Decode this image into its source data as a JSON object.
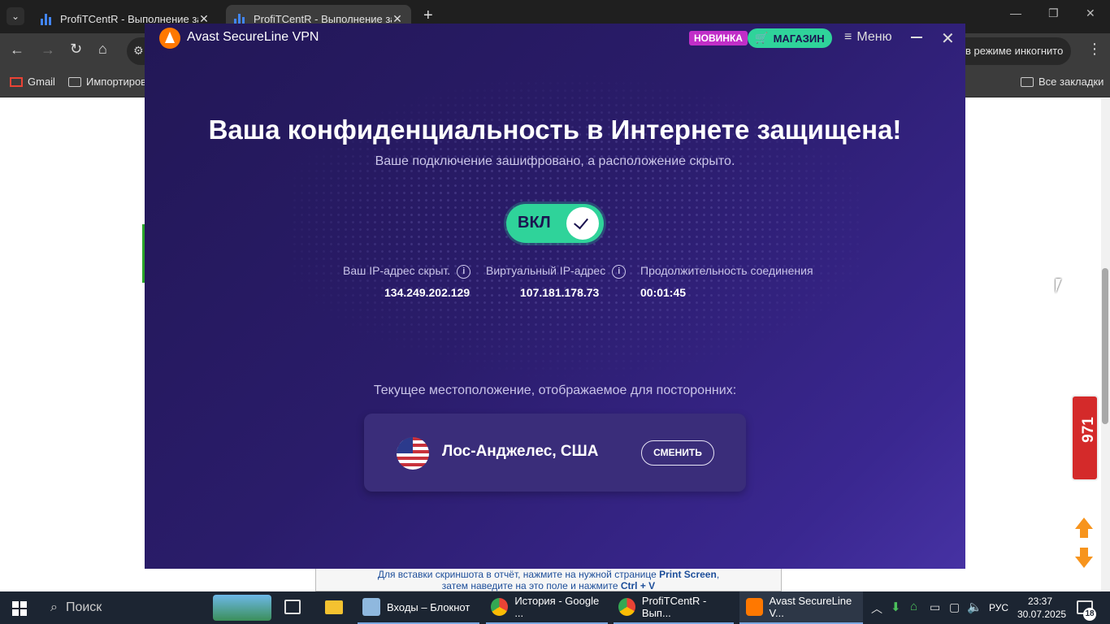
{
  "browser": {
    "tabs": [
      {
        "title": "ProfiTCentR - Выполнение зад",
        "active": false
      },
      {
        "title": "ProfiTCentR - Выполнение зад",
        "active": true
      }
    ],
    "omnibox_right": "в режиме инкогнито",
    "bookmarks": [
      {
        "label": "Gmail"
      },
      {
        "label": "Импортиров"
      }
    ],
    "all_bookmarks": "Все закладки"
  },
  "page_behind": {
    "hint_line1_a": "Для вставки скриншота в отчёт, нажмите на нужной странице ",
    "hint_line1_b": "Print Screen",
    "hint_line2_a": "затем наведите на это поле и нажмите ",
    "hint_line2_b": "Ctrl + V",
    "widget_number": "971"
  },
  "vpn": {
    "app_title": "Avast SecureLine VPN",
    "badge_new": "НОВИНКА",
    "shop_label": "МАГАЗИН",
    "menu_label": "Меню",
    "headline": "Ваша конфиденциальность в Интернете защищена!",
    "subline": "Ваше подключение зашифровано, а расположение скрыто.",
    "toggle_label": "ВКЛ",
    "toggle_on": true,
    "stats": [
      {
        "label": "Ваш IP-адрес скрыт.",
        "value": "134.249.202.129",
        "info": true
      },
      {
        "label": "Виртуальный IP-адрес",
        "value": "107.181.178.73",
        "info": true
      },
      {
        "label": "Продолжительность соединения",
        "value": "00:01:45",
        "info": false
      }
    ],
    "location_caption": "Текущее местоположение, отображаемое для посторонних:",
    "location_name": "Лос-Анджелес, США",
    "change_label": "СМЕНИТЬ"
  },
  "taskbar": {
    "search_placeholder": "Поиск",
    "items": [
      {
        "label": "Входы – Блокнот"
      },
      {
        "label": "История - Google ..."
      },
      {
        "label": "ProfiTCentR - Вып..."
      },
      {
        "label": "Avast SecureLine V..."
      }
    ],
    "language": "РУС",
    "time": "23:37",
    "date": "30.07.2025",
    "notifications": "18"
  },
  "colors": {
    "vpn_bg": "#2a1c6a",
    "accent_green": "#2fd39a",
    "badge_purple": "#c12ec8",
    "avast_orange": "#ff7800"
  }
}
